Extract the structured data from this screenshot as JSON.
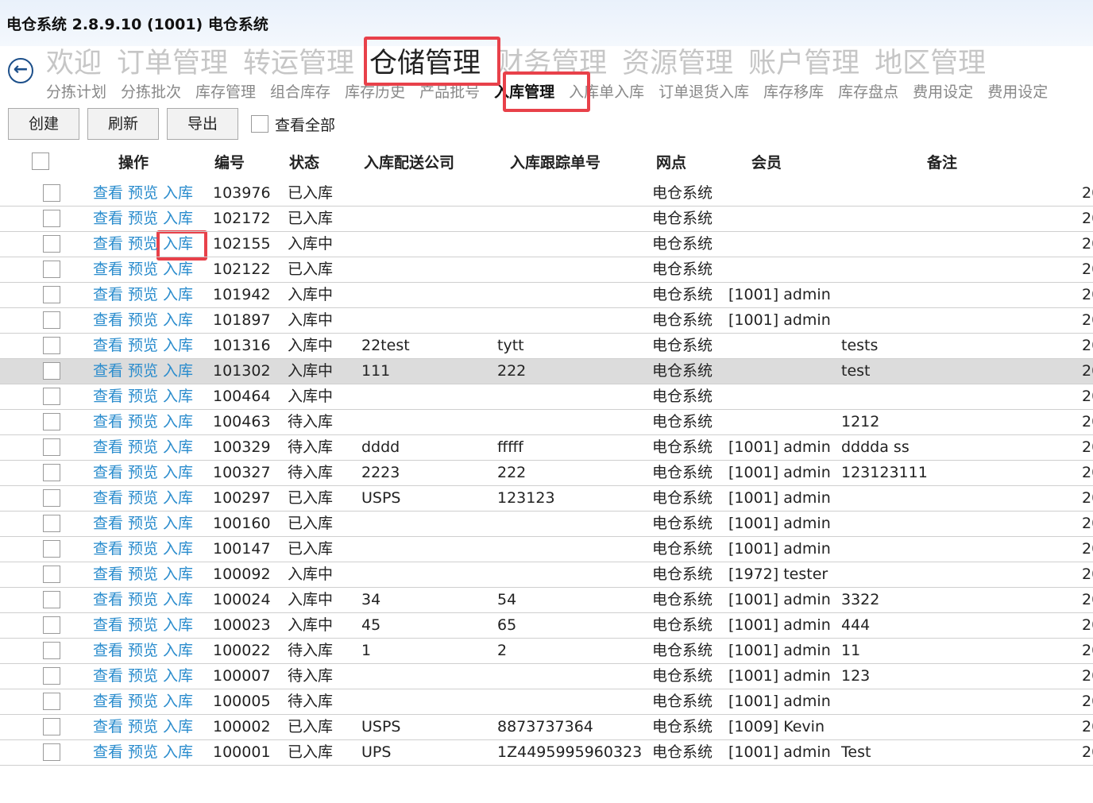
{
  "app": {
    "title": "电仓系统 2.8.9.10 (1001) 电仓系统"
  },
  "main_nav": [
    "欢迎",
    "订单管理",
    "转运管理",
    "仓储管理",
    "财务管理",
    "资源管理",
    "账户管理",
    "地区管理"
  ],
  "sub_nav": [
    "分拣计划",
    "分拣批次",
    "库存管理",
    "组合库存",
    "库存历史",
    "产品批号",
    "入库管理",
    "入库单入库",
    "订单退货入库",
    "库存移库",
    "库存盘点",
    "费用设定",
    "费用设定"
  ],
  "toolbar": {
    "create": "创建",
    "refresh": "刷新",
    "export": "导出",
    "view_all": "查看全部"
  },
  "columns": {
    "ops": "操作",
    "id": "编号",
    "status": "状态",
    "carrier": "入库配送公司",
    "tracking": "入库跟踪单号",
    "site": "网点",
    "member": "会员",
    "note": "备注"
  },
  "actions": {
    "view": "查看",
    "preview": "预览",
    "inbound": "入库"
  },
  "rows": [
    {
      "id": "103976",
      "status": "已入库",
      "carrier": "",
      "tracking": "",
      "site": "电仓系统",
      "member": "",
      "note": "",
      "date": "20"
    },
    {
      "id": "102172",
      "status": "已入库",
      "carrier": "",
      "tracking": "",
      "site": "电仓系统",
      "member": "",
      "note": "",
      "date": "20"
    },
    {
      "id": "102155",
      "status": "入库中",
      "carrier": "",
      "tracking": "",
      "site": "电仓系统",
      "member": "",
      "note": "",
      "date": "20"
    },
    {
      "id": "102122",
      "status": "已入库",
      "carrier": "",
      "tracking": "",
      "site": "电仓系统",
      "member": "",
      "note": "",
      "date": "20"
    },
    {
      "id": "101942",
      "status": "入库中",
      "carrier": "",
      "tracking": "",
      "site": "电仓系统",
      "member": "[1001] admin",
      "note": "",
      "date": "20"
    },
    {
      "id": "101897",
      "status": "入库中",
      "carrier": "",
      "tracking": "",
      "site": "电仓系统",
      "member": "[1001] admin",
      "note": "",
      "date": "20"
    },
    {
      "id": "101316",
      "status": "入库中",
      "carrier": "22test",
      "tracking": "tytt",
      "site": "电仓系统",
      "member": "",
      "note": "tests",
      "date": "20"
    },
    {
      "id": "101302",
      "status": "入库中",
      "carrier": "111",
      "tracking": "222",
      "site": "电仓系统",
      "member": "",
      "note": "test",
      "date": "20"
    },
    {
      "id": "100464",
      "status": "入库中",
      "carrier": "",
      "tracking": "",
      "site": "电仓系统",
      "member": "",
      "note": "",
      "date": "20"
    },
    {
      "id": "100463",
      "status": "待入库",
      "carrier": "",
      "tracking": "",
      "site": "电仓系统",
      "member": "",
      "note": "1212",
      "date": "20"
    },
    {
      "id": "100329",
      "status": "待入库",
      "carrier": "dddd",
      "tracking": "fffff",
      "site": "电仓系统",
      "member": "[1001] admin",
      "note": "ddddа ss",
      "date": "20"
    },
    {
      "id": "100327",
      "status": "待入库",
      "carrier": "2223",
      "tracking": "222",
      "site": "电仓系统",
      "member": "[1001] admin",
      "note": "123123111",
      "date": "20"
    },
    {
      "id": "100297",
      "status": "已入库",
      "carrier": "USPS",
      "tracking": "123123",
      "site": "电仓系统",
      "member": "[1001] admin",
      "note": "",
      "date": "20"
    },
    {
      "id": "100160",
      "status": "已入库",
      "carrier": "",
      "tracking": "",
      "site": "电仓系统",
      "member": "[1001] admin",
      "note": "",
      "date": "20"
    },
    {
      "id": "100147",
      "status": "已入库",
      "carrier": "",
      "tracking": "",
      "site": "电仓系统",
      "member": "[1001] admin",
      "note": "",
      "date": "20"
    },
    {
      "id": "100092",
      "status": "入库中",
      "carrier": "",
      "tracking": "",
      "site": "电仓系统",
      "member": "[1972] tester",
      "note": "",
      "date": "20"
    },
    {
      "id": "100024",
      "status": "入库中",
      "carrier": "34",
      "tracking": "54",
      "site": "电仓系统",
      "member": "[1001] admin",
      "note": "3322",
      "date": "20"
    },
    {
      "id": "100023",
      "status": "入库中",
      "carrier": "45",
      "tracking": "65",
      "site": "电仓系统",
      "member": "[1001] admin",
      "note": "444",
      "date": "20"
    },
    {
      "id": "100022",
      "status": "待入库",
      "carrier": "1",
      "tracking": "2",
      "site": "电仓系统",
      "member": "[1001] admin",
      "note": "11",
      "date": "20"
    },
    {
      "id": "100007",
      "status": "待入库",
      "carrier": "",
      "tracking": "",
      "site": "电仓系统",
      "member": "[1001] admin",
      "note": "123",
      "date": "20"
    },
    {
      "id": "100005",
      "status": "待入库",
      "carrier": "",
      "tracking": "",
      "site": "电仓系统",
      "member": "[1001] admin",
      "note": "",
      "date": "20"
    },
    {
      "id": "100002",
      "status": "已入库",
      "carrier": "USPS",
      "tracking": "8873737364",
      "site": "电仓系统",
      "member": "[1009] Kevin",
      "note": "",
      "date": "20"
    },
    {
      "id": "100001",
      "status": "已入库",
      "carrier": "UPS",
      "tracking": "1Z4495995960323",
      "site": "电仓系统",
      "member": "[1001] admin",
      "note": "Test",
      "date": "20"
    }
  ],
  "selected_row_index": 7,
  "highlight_color": "#e8414a",
  "link_color": "#2a8ccd"
}
